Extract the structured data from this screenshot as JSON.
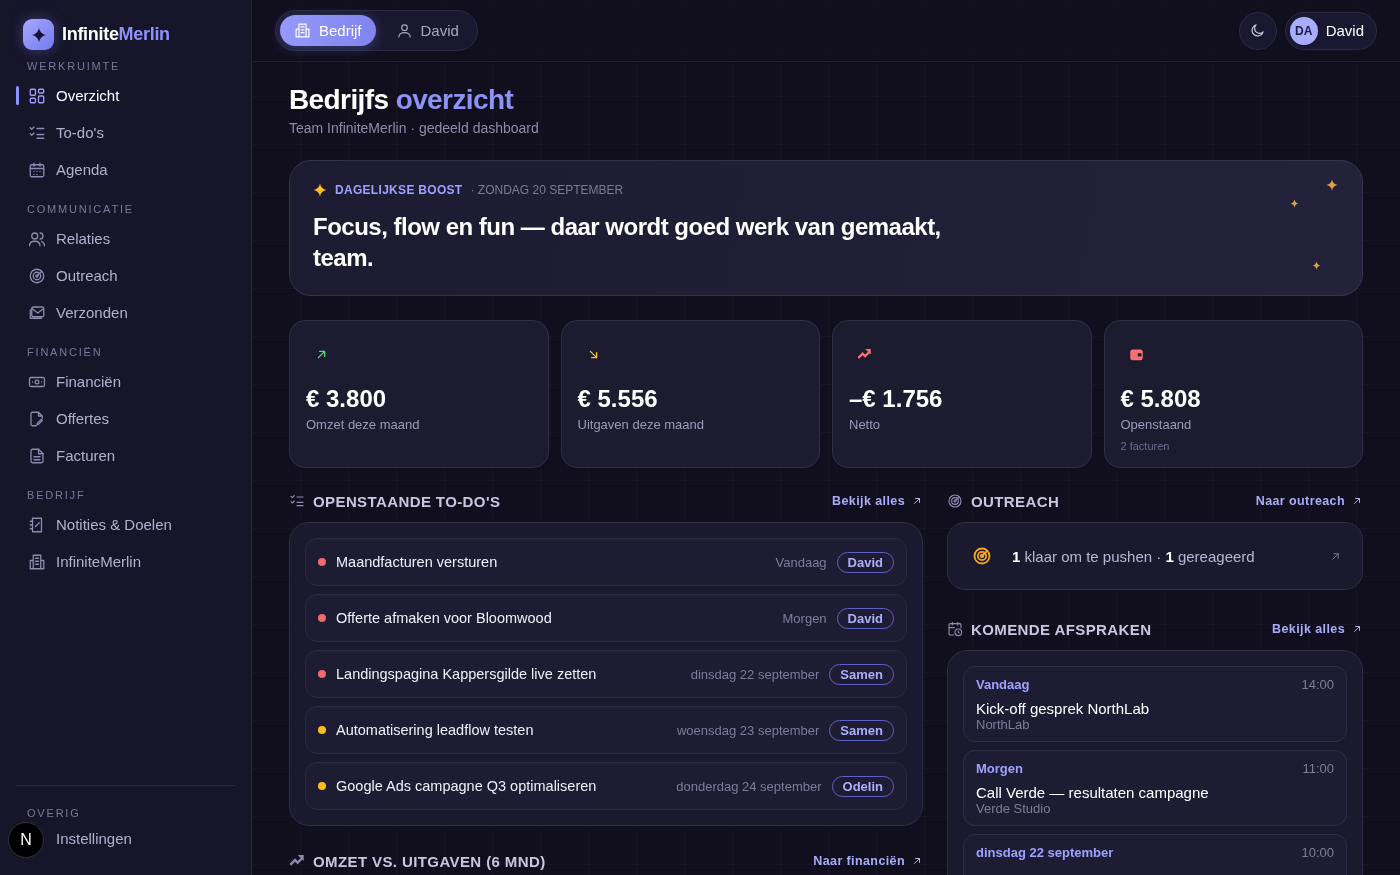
{
  "brand": {
    "name": "Infinite",
    "accent": "Merlin"
  },
  "sidebar": {
    "sections": [
      {
        "label": "WERKRUIMTE",
        "items": [
          {
            "label": "Overzicht",
            "selected": true
          },
          {
            "label": "To-do's",
            "selected": false
          },
          {
            "label": "Agenda",
            "selected": false
          }
        ]
      },
      {
        "label": "COMMUNICATIE",
        "items": [
          {
            "label": "Relaties",
            "selected": false
          },
          {
            "label": "Outreach",
            "selected": false
          },
          {
            "label": "Verzonden",
            "selected": false
          }
        ]
      },
      {
        "label": "FINANCIËN",
        "items": [
          {
            "label": "Financiën",
            "selected": false
          },
          {
            "label": "Offertes",
            "selected": false
          },
          {
            "label": "Facturen",
            "selected": false
          }
        ]
      },
      {
        "label": "BEDRIJF",
        "items": [
          {
            "label": "Notities & Doelen",
            "selected": false
          },
          {
            "label": "InfiniteMerlin",
            "selected": false
          }
        ]
      }
    ],
    "footer": {
      "label": "OVERIG",
      "item": {
        "label": "Instellingen"
      },
      "dev_badge": "N"
    }
  },
  "topbar": {
    "tabs": [
      {
        "label": "Bedrijf",
        "selected": true
      },
      {
        "label": "David",
        "selected": false
      }
    ],
    "user": {
      "initials": "DA",
      "name": "David"
    }
  },
  "heading": {
    "title": "Bedrijfs",
    "accent": "overzicht",
    "subtitle": "Team InfiniteMerlin · gedeeld dashboard"
  },
  "boost": {
    "label": "DAGELIJKSE BOOST",
    "date": "· ZONDAG 20 SEPTEMBER",
    "quote": "Focus, flow en fun — daar wordt goed werk van gemaakt, team."
  },
  "stats": [
    {
      "value": "€ 3.800",
      "label": "Omzet deze maand",
      "color": "#4ade80"
    },
    {
      "value": "€ 5.556",
      "label": "Uitgaven deze maand",
      "color": "#fbbf24"
    },
    {
      "value": "–€ 1.756",
      "label": "Netto",
      "color": "#f87171"
    },
    {
      "value": "€ 5.808",
      "label": "Openstaand",
      "note": "2 facturen",
      "color": "#f87171"
    }
  ],
  "todos": {
    "title": "OPENSTAANDE TO-DO'S",
    "link": "Bekijk alles",
    "items": [
      {
        "title": "Maandfacturen versturen",
        "due": "Vandaag",
        "owner": "David",
        "color": "#f06b6b"
      },
      {
        "title": "Offerte afmaken voor Bloomwood",
        "due": "Morgen",
        "owner": "David",
        "color": "#f06b6b"
      },
      {
        "title": "Landingspagina Kappersgilde live zetten",
        "due": "dinsdag 22 september",
        "owner": "Samen",
        "color": "#f06b6b"
      },
      {
        "title": "Automatisering leadflow testen",
        "due": "woensdag 23 september",
        "owner": "Samen",
        "color": "#fbbf24"
      },
      {
        "title": "Google Ads campagne Q3 optimaliseren",
        "due": "donderdag 24 september",
        "owner": "Odelin",
        "color": "#fbbf24"
      }
    ]
  },
  "chart_section": {
    "title": "OMZET VS. UITGAVEN (6 MND)",
    "link": "Naar financiën"
  },
  "outreach": {
    "title": "OUTREACH",
    "link": "Naar outreach",
    "summary": "**1** klaar om te pushen · **1** gereageerd"
  },
  "appointments": {
    "title": "KOMENDE AFSPRAKEN",
    "link": "Bekijk alles",
    "items": [
      {
        "day": "Vandaag",
        "time": "14:00",
        "title": "Kick-off gesprek NorthLab",
        "client": "NorthLab"
      },
      {
        "day": "Morgen",
        "time": "11:00",
        "title": "Call Verde — resultaten campagne",
        "client": "Verde Studio"
      },
      {
        "day": "dinsdag 22 september",
        "time": "10:00"
      }
    ]
  }
}
